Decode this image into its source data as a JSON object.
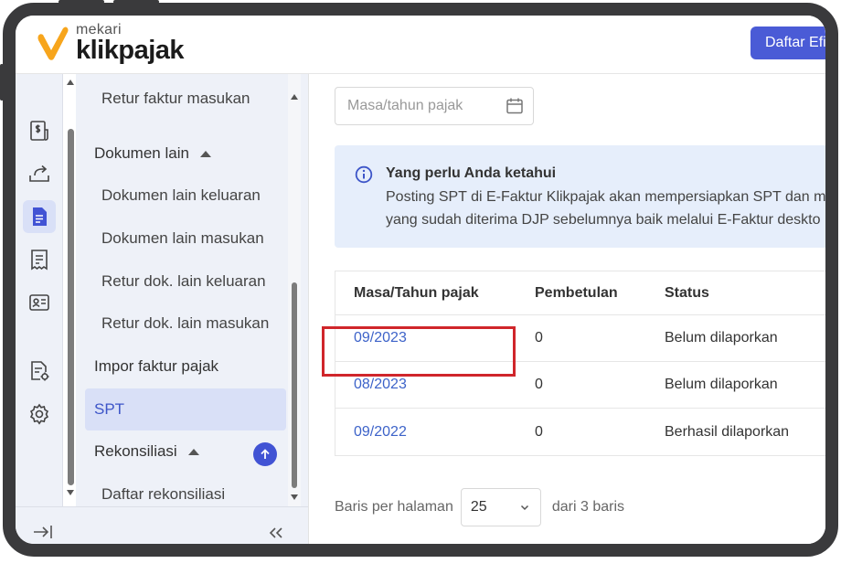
{
  "header": {
    "logo_small": "mekari",
    "logo_big": "klikpajak",
    "efiling_button": "Daftar Efi"
  },
  "rail": {
    "icons": [
      "invoice-dollar-icon",
      "upload-tray-icon",
      "document-active-icon",
      "receipt-icon",
      "id-card-icon",
      "document-settings-icon",
      "gear-icon",
      "expand-arrow-icon"
    ]
  },
  "sidebar": {
    "items": [
      {
        "label": "Retur faktur masukan"
      },
      {
        "label": "Dokumen lain"
      },
      {
        "label": "Dokumen lain keluaran"
      },
      {
        "label": "Dokumen lain masukan"
      },
      {
        "label": "Retur dok. lain keluaran"
      },
      {
        "label": "Retur dok. lain masukan"
      },
      {
        "label": "Impor faktur pajak"
      },
      {
        "label": "SPT"
      },
      {
        "label": "Rekonsiliasi"
      },
      {
        "label": "Daftar rekonsiliasi"
      }
    ],
    "collapse_icon": "double-chevron-left-icon"
  },
  "main": {
    "period_placeholder": "Masa/tahun pajak",
    "info": {
      "title": "Yang perlu Anda ketahui",
      "line1": "Posting SPT di E-Faktur Klikpajak akan mempersiapkan SPT dan m",
      "line2": "yang sudah diterima DJP sebelumnya baik melalui E-Faktur deskto"
    },
    "table": {
      "headers": [
        "Masa/Tahun pajak",
        "Pembetulan",
        "Status"
      ],
      "rows": [
        {
          "period": "09/2023",
          "revision": "0",
          "status": "Belum dilaporkan"
        },
        {
          "period": "08/2023",
          "revision": "0",
          "status": "Belum dilaporkan"
        },
        {
          "period": "09/2022",
          "revision": "0",
          "status": "Berhasil dilaporkan"
        }
      ]
    },
    "pager": {
      "rows_per_page_label": "Baris per halaman",
      "rows_per_page_value": "25",
      "total_label": "dari 3 baris"
    }
  },
  "colors": {
    "accent": "#4153d4",
    "link": "#3d63c9",
    "highlight": "#d0262b",
    "sidebar_bg": "#eef1f8"
  }
}
